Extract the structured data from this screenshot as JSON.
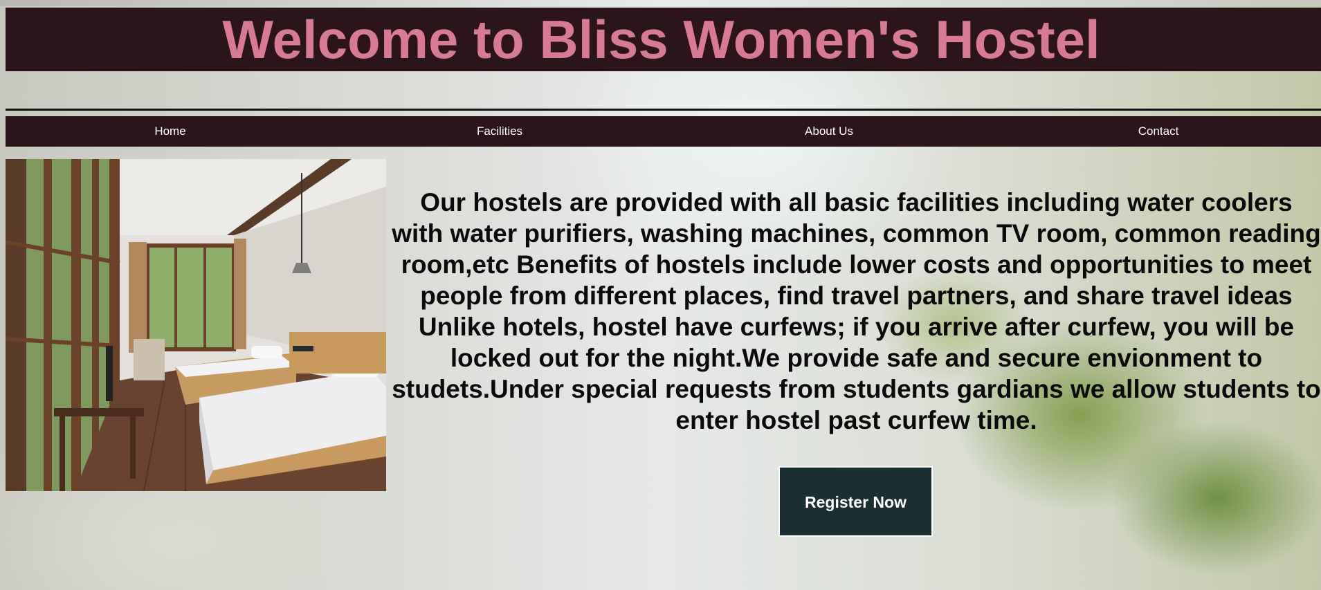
{
  "header": {
    "title": "Welcome to Bliss Women's Hostel"
  },
  "nav": {
    "items": [
      {
        "label": "Home"
      },
      {
        "label": "Facilities"
      },
      {
        "label": "About Us"
      },
      {
        "label": "Contact"
      }
    ]
  },
  "main": {
    "image": {
      "subject": "hostel bedroom with two beds and large windows"
    },
    "description": "Our hostels are provided with all basic facilities including water coolers with water purifiers, washing machines, common TV room, common reading room,etc Benefits of hostels include lower costs and opportunities to meet people from different places, find travel partners, and share travel ideas Unlike hotels, hostel have curfews; if you arrive after curfew, you will be locked out for the night.We provide safe and secure envionment to studets.Under special requests from students gardians we allow students to enter hostel past curfew time.",
    "register_label": "Register Now"
  },
  "colors": {
    "header_bg": "#2c141b",
    "title_color": "#d77a94",
    "nav_text": "#ffffff",
    "button_bg": "#1b2e31"
  }
}
